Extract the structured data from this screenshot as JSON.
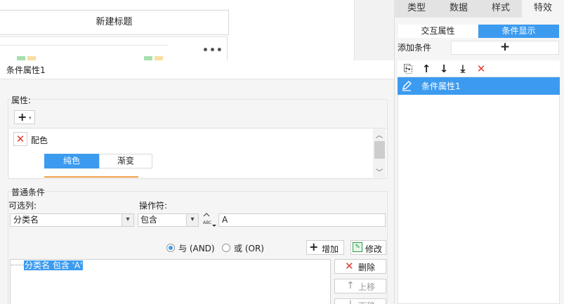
{
  "canvas": {
    "title_card": "新建标题",
    "more": "•••"
  },
  "right_panel": {
    "tabs": [
      {
        "label": "类型"
      },
      {
        "label": "数据"
      },
      {
        "label": "样式"
      },
      {
        "label": "特效"
      }
    ],
    "subtabs": {
      "left": "交互属性",
      "right": "条件显示"
    },
    "add_condition_label": "添加条件",
    "add_condition_btn": "+",
    "toolbar": {
      "copy": "⎘",
      "up": "↑",
      "down": "↓",
      "bottom": "⤓",
      "delete": "✕"
    },
    "items": [
      {
        "label": "条件属性1",
        "icon": "pencil-icon"
      }
    ],
    "accent": "#3d9bef"
  },
  "dialog": {
    "title": "条件属性1",
    "properties": {
      "legend": "属性:",
      "add_btn": "+",
      "add_caret": "▾",
      "item_name": "配色",
      "item_delete": "✕",
      "segments": {
        "solid": "纯色",
        "gradient": "渐变"
      },
      "scroll_up": "︿",
      "scroll_down": "﹀"
    },
    "conditions": {
      "legend": "普通条件",
      "column_label": "可选列:",
      "operator_label": "操作符:",
      "column_value": "分类名",
      "operator_value": "包含",
      "caret": "▾",
      "value_input": "A",
      "abc_icon_text": "ABC",
      "and_label": "与 (AND)",
      "or_label": "或 (OR)",
      "selected_logic": "and",
      "add_btn": "增加",
      "add_btn_icon": "+",
      "modify_btn": "修改",
      "modify_icon": "✎",
      "expression": "分类名 包含 'A'",
      "delete_btn": "删除",
      "delete_icon": "✕",
      "move_up_btn": "上移",
      "move_up_icon": "↑",
      "move_down_btn": "下移",
      "move_down_icon": "↓"
    }
  }
}
